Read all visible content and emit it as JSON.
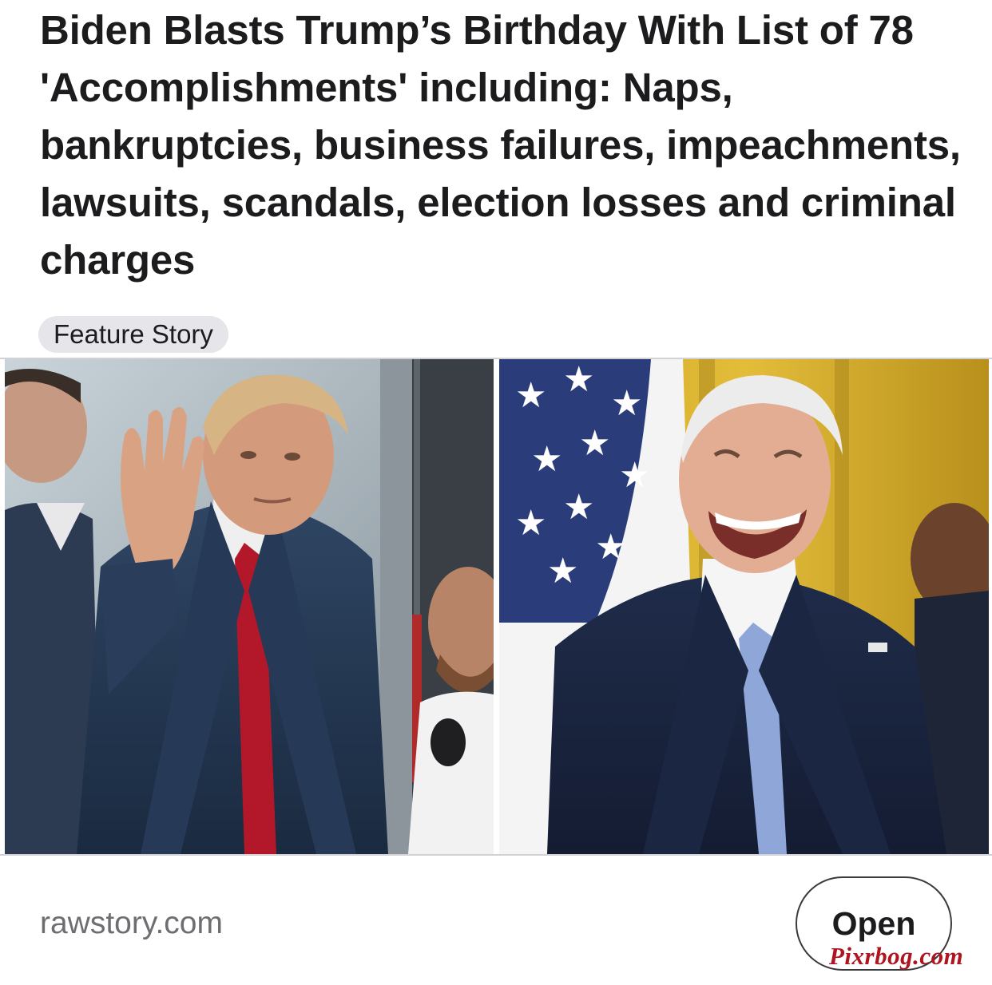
{
  "article": {
    "headline": "Biden Blasts Trump’s Birthday With List of 78 'Accomplishments' including: Naps, bankruptcies, business failures, impeachments, lawsuits, scandals, election losses and criminal charges",
    "badge": "Feature Story",
    "source": "rawstory.com",
    "open_label": "Open",
    "watermark": "Pixrbog.com"
  },
  "colors": {
    "text": "#1c1c1e",
    "secondary_text": "#6d6d72",
    "badge_bg": "#e5e5ea",
    "watermark": "#b0141e"
  }
}
